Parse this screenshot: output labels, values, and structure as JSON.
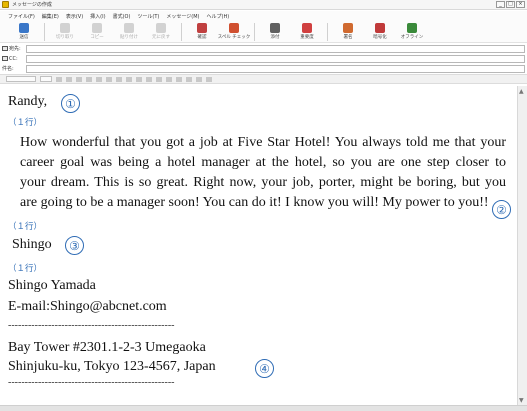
{
  "window": {
    "title": "メッセージの作成",
    "controls": [
      "_",
      "□",
      "×"
    ]
  },
  "menu": [
    "ファイル(F)",
    "編集(E)",
    "表示(V)",
    "挿入(I)",
    "書式(O)",
    "ツール(T)",
    "メッセージ(M)",
    "ヘルプ(H)"
  ],
  "toolbar": [
    {
      "label": "送信",
      "icon": "send-icon",
      "enabled": true,
      "color": "#3a77c8"
    },
    {
      "label": "切り取り",
      "icon": "cut-icon",
      "enabled": false,
      "color": "#888888"
    },
    {
      "label": "コピー",
      "icon": "copy-icon",
      "enabled": false,
      "color": "#888888"
    },
    {
      "label": "貼り付け",
      "icon": "paste-icon",
      "enabled": false,
      "color": "#888888"
    },
    {
      "label": "元に戻す",
      "icon": "undo-icon",
      "enabled": false,
      "color": "#888888"
    },
    {
      "label": "確認",
      "icon": "check-names-icon",
      "enabled": true,
      "color": "#c04040"
    },
    {
      "label": "スペル チェック",
      "icon": "spell-check-icon",
      "enabled": true,
      "color": "#d05030"
    },
    {
      "label": "添付",
      "icon": "attach-icon",
      "enabled": true,
      "color": "#606060"
    },
    {
      "label": "重要度",
      "icon": "priority-icon",
      "enabled": true,
      "color": "#d04040"
    },
    {
      "label": "署名",
      "icon": "sign-icon",
      "enabled": true,
      "color": "#d06a30"
    },
    {
      "label": "暗号化",
      "icon": "encrypt-icon",
      "enabled": true,
      "color": "#c03a3a"
    },
    {
      "label": "オフライン",
      "icon": "offline-icon",
      "enabled": true,
      "color": "#3a8a3a"
    }
  ],
  "header": {
    "to_label": "宛先:",
    "cc_label": "CC:",
    "subject_label": "件名:",
    "to_value": "",
    "cc_value": "",
    "subject_value": ""
  },
  "body": {
    "greeting": "Randy,",
    "note_one_line": "（１行）",
    "paragraph_lines": [
      "How wonderful that you got a job at Five Star Hotel! You always told me that your",
      "career goal was being a hotel manager at the hotel, so you are one step closer to",
      "your dream. This is so great. Right now, your job, porter, might be boring, but you",
      "are going to be a manager soon! You can do it! I know you will! My power to you!!"
    ],
    "sign_name": "Shingo",
    "full_name": "Shingo Yamada",
    "email": "E-mail:Shingo@abcnet.com",
    "separator": "--------------------------------------------------",
    "address1": "Bay Tower #2301.1-2-3 Umegaoka",
    "address2": "Shinjuku-ku, Tokyo 123-4567, Japan",
    "markers": [
      "①",
      "②",
      "③",
      "④"
    ]
  },
  "colors": {
    "annotation": "#2f6cb5"
  }
}
